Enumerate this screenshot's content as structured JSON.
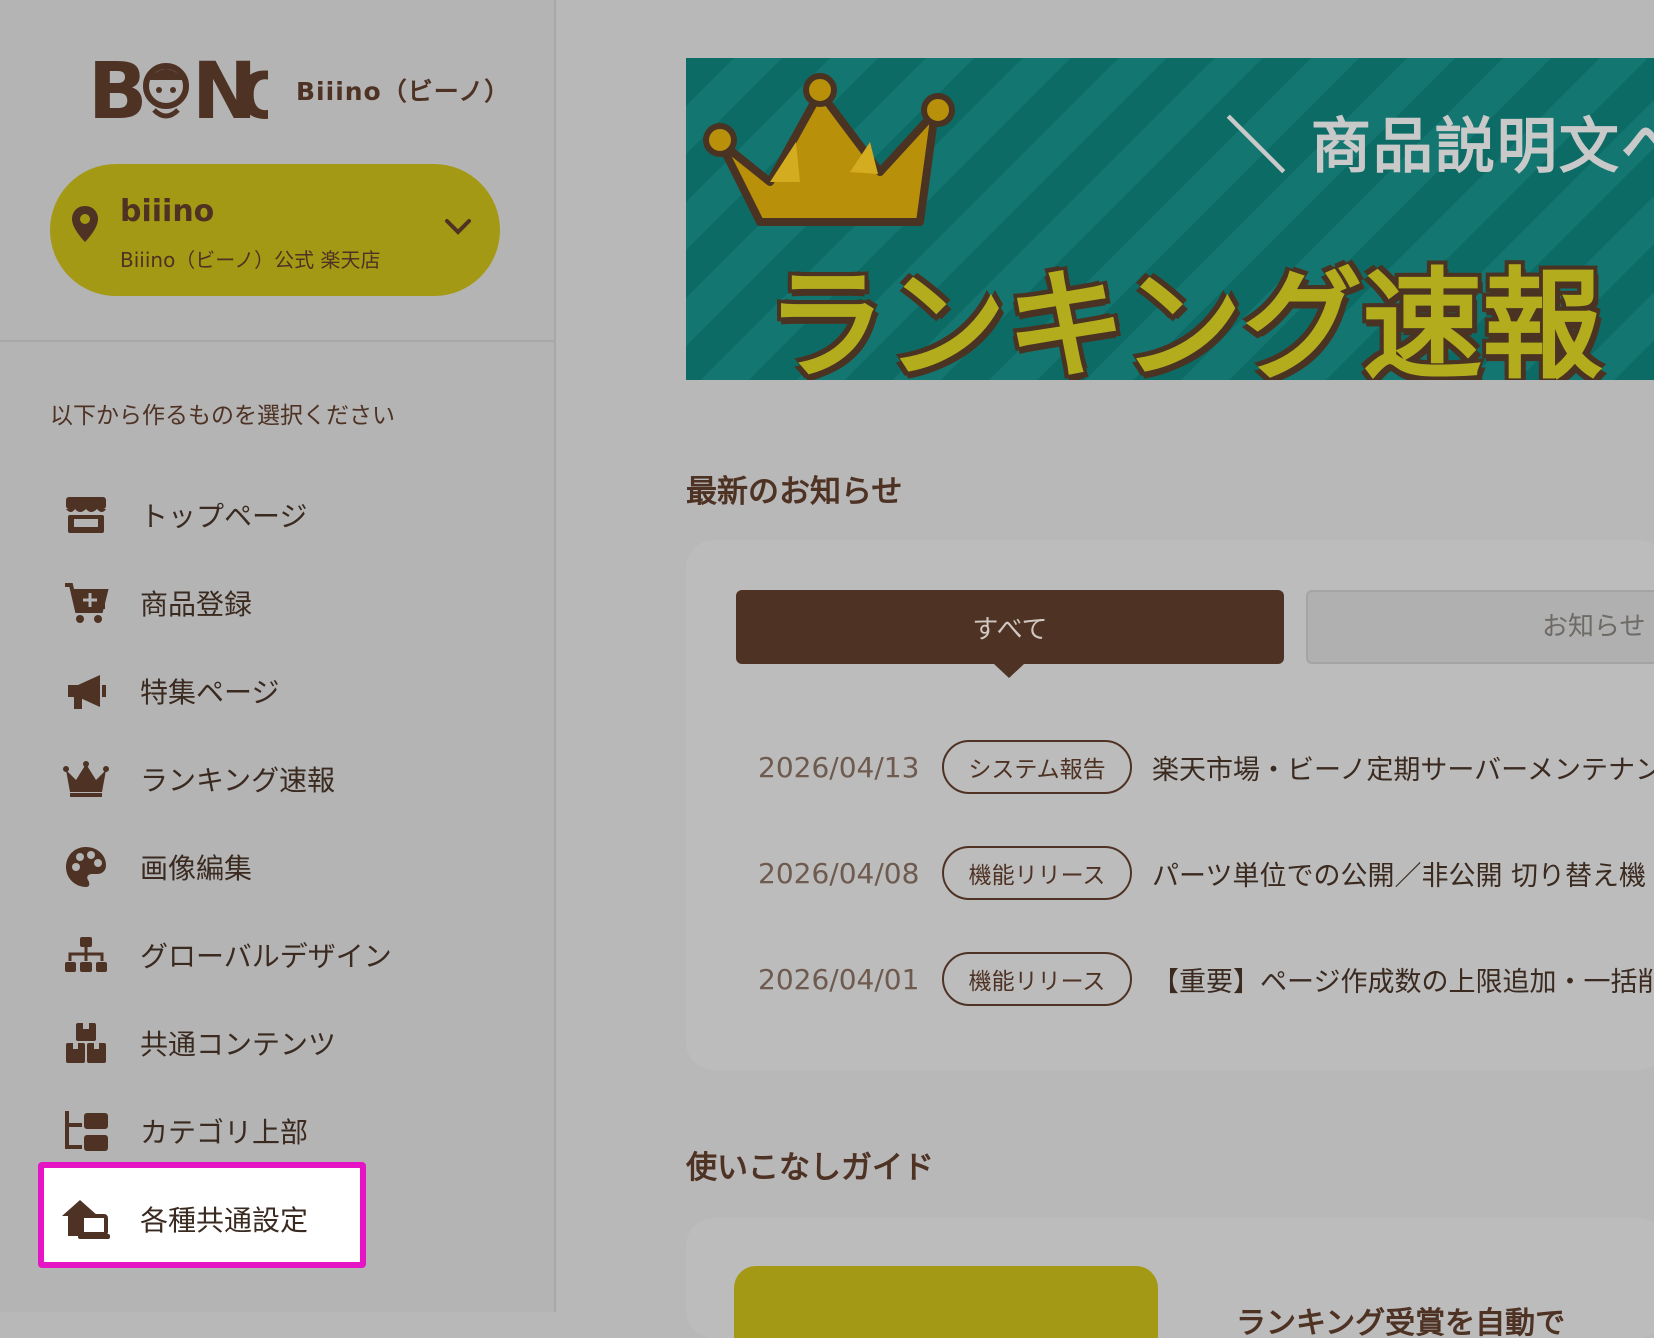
{
  "brand": {
    "logo_text": "BIINO",
    "name": "Biiino（ビーノ）"
  },
  "store": {
    "name": "biiino",
    "subtitle": "Biiino（ビーノ）公式 楽天店"
  },
  "sidebar": {
    "prompt": "以下から作るものを選択ください",
    "items": [
      {
        "label": "トップページ",
        "icon": "storefront-icon"
      },
      {
        "label": "商品登録",
        "icon": "cart-plus-icon"
      },
      {
        "label": "特集ページ",
        "icon": "megaphone-icon"
      },
      {
        "label": "ランキング速報",
        "icon": "crown-icon"
      },
      {
        "label": "画像編集",
        "icon": "palette-icon"
      },
      {
        "label": "グローバルデザイン",
        "icon": "sitemap-icon"
      },
      {
        "label": "共通コンテンツ",
        "icon": "boxes-icon"
      },
      {
        "label": "カテゴリ上部",
        "icon": "folder-tree-icon"
      },
      {
        "label": "各種共通設定",
        "icon": "house-laptop-icon"
      }
    ],
    "highlight_color": "#e514c4"
  },
  "banner": {
    "subtitle": "＼ 商品説明文への",
    "title": "ランキング速報"
  },
  "news": {
    "title": "最新のお知らせ",
    "tabs": {
      "all": "すべて",
      "notice": "お知らせ"
    },
    "items": [
      {
        "date": "2026/04/13",
        "badge": "システム報告",
        "text": "楽天市場・ビーノ定期サーバーメンテナン"
      },
      {
        "date": "2026/04/08",
        "badge": "機能リリース",
        "text": "パーツ単位での公開／非公開 切り替え機"
      },
      {
        "date": "2026/04/01",
        "badge": "機能リリース",
        "text": "【重要】ページ作成数の上限追加・一括削"
      }
    ]
  },
  "guide": {
    "title": "使いこなしガイド",
    "item_text": "ランキング受賞を自動で"
  },
  "colors": {
    "brown": "#4e3224",
    "olive": "#a49914",
    "teal": "#0d6b66"
  }
}
